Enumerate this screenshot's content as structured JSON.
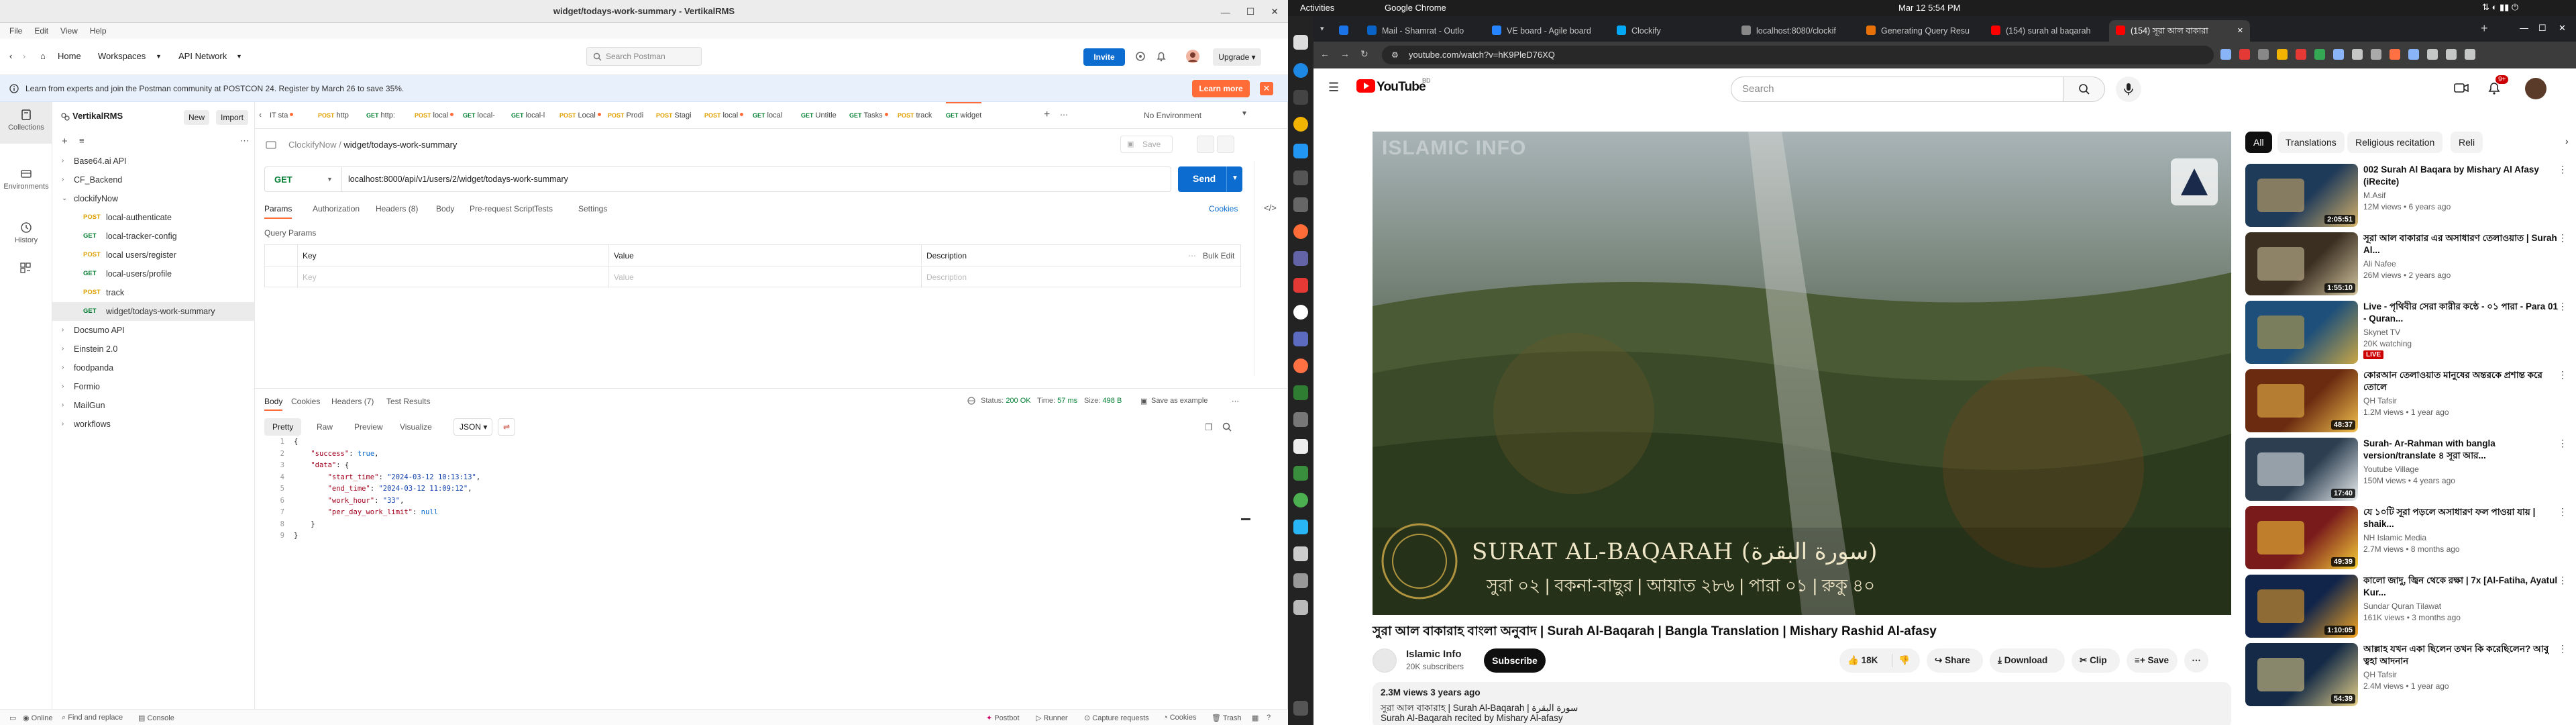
{
  "postman": {
    "window_title": "widget/todays-work-summary - VertikalRMS",
    "menu": [
      "File",
      "Edit",
      "View",
      "Help"
    ],
    "header": {
      "home": "Home",
      "workspaces": "Workspaces",
      "api_network": "API Network",
      "search_placeholder": "Search Postman",
      "invite": "Invite",
      "upgrade": "Upgrade"
    },
    "banner": {
      "text": "Learn from experts and join the Postman community at POSTCON 24. Register by March 26 to save 35%.",
      "button": "Learn more"
    },
    "iconbar": [
      "Collections",
      "Environments",
      "History"
    ],
    "sidebar": {
      "workspace": "VertikalRMS",
      "new": "New",
      "import": "Import",
      "tree": [
        {
          "label": "Base64.ai API",
          "method": "",
          "level": 0,
          "open": false
        },
        {
          "label": "CF_Backend",
          "method": "",
          "level": 0,
          "open": false
        },
        {
          "label": "clockifyNow",
          "method": "",
          "level": 0,
          "open": true
        },
        {
          "label": "local-authenticate",
          "method": "POST",
          "level": 1
        },
        {
          "label": "local-tracker-config",
          "method": "GET",
          "level": 1
        },
        {
          "label": "local users/register",
          "method": "POST",
          "level": 1
        },
        {
          "label": "local-users/profile",
          "method": "GET",
          "level": 1
        },
        {
          "label": "track",
          "method": "POST",
          "level": 1
        },
        {
          "label": "widget/todays-work-summary",
          "method": "GET",
          "level": 1,
          "active": true
        },
        {
          "label": "Docsumo API",
          "method": "",
          "level": 0,
          "open": false
        },
        {
          "label": "Einstein 2.0",
          "method": "",
          "level": 0,
          "open": false
        },
        {
          "label": "foodpanda",
          "method": "",
          "level": 0,
          "open": false
        },
        {
          "label": "Formio",
          "method": "",
          "level": 0,
          "open": false
        },
        {
          "label": "MailGun",
          "method": "",
          "level": 0,
          "open": false
        },
        {
          "label": "workflows",
          "method": "",
          "level": 0,
          "open": false
        }
      ]
    },
    "tabs": [
      {
        "m": "",
        "l": "IT sta"
      },
      {
        "m": "POST",
        "l": "http"
      },
      {
        "m": "GET",
        "l": "http:"
      },
      {
        "m": "POST",
        "l": "local"
      },
      {
        "m": "GET",
        "l": "local-"
      },
      {
        "m": "GET",
        "l": "local-l"
      },
      {
        "m": "POST",
        "l": "Local"
      },
      {
        "m": "POST",
        "l": "Prodi"
      },
      {
        "m": "POST",
        "l": "Stagi"
      },
      {
        "m": "POST",
        "l": "local"
      },
      {
        "m": "GET",
        "l": "local"
      },
      {
        "m": "GET",
        "l": "Untitle"
      },
      {
        "m": "GET",
        "l": "Tasks"
      },
      {
        "m": "POST",
        "l": "track"
      },
      {
        "m": "GET",
        "l": "widget"
      }
    ],
    "environment": "No Environment",
    "breadcrumb_parent": "ClockifyNow",
    "breadcrumb_current": "widget/todays-work-summary",
    "save": "Save",
    "request": {
      "method": "GET",
      "url": "localhost:8000/api/v1/users/2/widget/todays-work-summary",
      "send": "Send"
    },
    "req_tabs": [
      "Params",
      "Authorization",
      "Headers (8)",
      "Body",
      "Pre-request Script",
      "Tests",
      "Settings"
    ],
    "cookies": "Cookies",
    "query_params_title": "Query Params",
    "qp_headers": {
      "key": "Key",
      "value": "Value",
      "description": "Description",
      "bulk": "Bulk Edit"
    },
    "qp_placeholders": {
      "key": "Key",
      "value": "Value",
      "description": "Description"
    },
    "response": {
      "tabs": [
        "Body",
        "Cookies",
        "Headers (7)",
        "Test Results"
      ],
      "status_label": "Status:",
      "status": "200 OK",
      "time_label": "Time:",
      "time": "57 ms",
      "size_label": "Size:",
      "size": "498 B",
      "save_example": "Save as example",
      "formats": [
        "Pretty",
        "Raw",
        "Preview",
        "Visualize"
      ],
      "lang": "JSON"
    },
    "code_lines": [
      {
        "n": "1",
        "text": "{"
      },
      {
        "n": "2",
        "text": "    \"success\": true,"
      },
      {
        "n": "3",
        "text": "    \"data\": {"
      },
      {
        "n": "4",
        "text": "        \"start_time\": \"2024-03-12 10:13:13\","
      },
      {
        "n": "5",
        "text": "        \"end_time\": \"2024-03-12 11:09:12\","
      },
      {
        "n": "6",
        "text": "        \"work_hour\": \"33\","
      },
      {
        "n": "7",
        "text": "        \"per_day_work_limit\": null"
      },
      {
        "n": "8",
        "text": "    }"
      },
      {
        "n": "9",
        "text": "}"
      }
    ],
    "status_bar": {
      "online": "Online",
      "find": "Find and replace",
      "console": "Console",
      "postbot": "Postbot",
      "runner": "Runner",
      "capture": "Capture requests",
      "cookies": "Cookies",
      "trash": "Trash"
    }
  },
  "ubuntu": {
    "activities": "Activities",
    "app": "Google Chrome",
    "clock": "Mar 12  5:54 PM"
  },
  "chrome": {
    "tabs": [
      {
        "label": "",
        "color": "#1a73e8"
      },
      {
        "label": "Mail - Shamrat - Outlo",
        "color": "#0a64c8"
      },
      {
        "label": "VE board - Agile board",
        "color": "#2684ff"
      },
      {
        "label": "Clockify",
        "color": "#03a9f4"
      },
      {
        "label": "localhost:8080/clockif",
        "color": "#888888"
      },
      {
        "label": "Generating Query Resu",
        "color": "#e8710a"
      },
      {
        "label": "(154) surah al baqarah",
        "color": "#ff0000"
      },
      {
        "label": "(154) সূরা আল বাকারা",
        "color": "#ff0000"
      }
    ],
    "url": "youtube.com/watch?v=hK9PleD76XQ"
  },
  "youtube": {
    "logo": "YouTube",
    "logo_sup": "BD",
    "search_placeholder": "Search",
    "notif_count": "9+",
    "video_overlay_brand": "ISLAMIC INFO",
    "video_overlay_title": "SURAT AL-BAQARAH (سورة البقرة)",
    "video_overlay_sub": "সুরা ০২ | বকনা-বাছুর | আয়াত ২৮৬ | পারা ০১ | রুকু ৪০",
    "title": "সুরা আল বাকারাহ বাংলা অনুবাদ | Surah Al-Baqarah | Bangla Translation | Mishary Rashid Al-afasy",
    "channel": "Islamic Info",
    "subs": "20K subscribers",
    "subscribe": "Subscribe",
    "likes": "18K",
    "share": "Share",
    "download": "Download",
    "clip": "Clip",
    "save": "Save",
    "desc_meta": "2.3M views  3 years ago",
    "desc_line1": "সুরা আল বাকারাহ | Surah Al-Baqarah | سورة البقرة",
    "desc_line2": "Surah Al-Baqarah recited by Mishary Al-afasy",
    "chips": [
      "All",
      "Translations",
      "Religious recitation",
      "Reli"
    ],
    "recs": [
      {
        "title": "002 Surah Al Baqara by Mishary Al Afasy (iRecite)",
        "channel": "M.Asif",
        "meta": "12M views • 6 years ago",
        "dur": "2:05:51",
        "c1": "#1f3b5a",
        "c2": "#d8b36a"
      },
      {
        "title": "সূরা আল বাকারার এর অসাধারণ তেলাওয়াত | Surah Al...",
        "channel": "Ali Nafee",
        "meta": "26M views • 2 years ago",
        "dur": "1:55:10",
        "c1": "#3b2f22",
        "c2": "#d4c6a0"
      },
      {
        "title": "Live - পৃথিবীর সেরা কারীর কন্ঠে - ০১ পারা - Para 01 - Quran...",
        "channel": "Skynet TV",
        "meta": "20K watching",
        "dur": "",
        "live": "LIVE",
        "c1": "#1d4f7a",
        "c2": "#c9a646"
      },
      {
        "title": "কোরআন তেলাওয়াত মানুষের অন্তরকে প্রশান্ত করে তোলে",
        "channel": "QH Tafsir",
        "meta": "1.2M views • 1 year ago",
        "dur": "48:37",
        "c1": "#6b2b10",
        "c2": "#f2c14e"
      },
      {
        "title": "Surah- Ar-Rahman with bangla version/translate ৪ সূরা আর...",
        "channel": "Youtube Village",
        "meta": "150M views • 4 years ago",
        "dur": "17:40",
        "c1": "#2c3e50",
        "c2": "#ecf0f1"
      },
      {
        "title": "যে ১০টি সূরা পড়লে অসাধারণ ফল পাওয়া যায় | shaik...",
        "channel": "NH Islamic Media",
        "meta": "2.7M views • 8 months ago",
        "dur": "49:39",
        "c1": "#7a1b1b",
        "c2": "#f7d038"
      },
      {
        "title": "কালো জাদু, জ্বিন থেকে রক্ষা | 7x [Al-Fatiha, Ayatul Kur...",
        "channel": "Sundar Quran Tilawat",
        "meta": "161K views • 3 months ago",
        "dur": "1:10:05",
        "c1": "#11244a",
        "c2": "#f5a623"
      },
      {
        "title": "আল্লাহ যখন একা ছিলেন তখন কি করেছিলেন? আবু ত্বহা আদনান",
        "channel": "QH Tafsir",
        "meta": "2.4M views • 1 year ago",
        "dur": "54:39",
        "c1": "#142a46",
        "c2": "#e8d28a"
      }
    ]
  }
}
